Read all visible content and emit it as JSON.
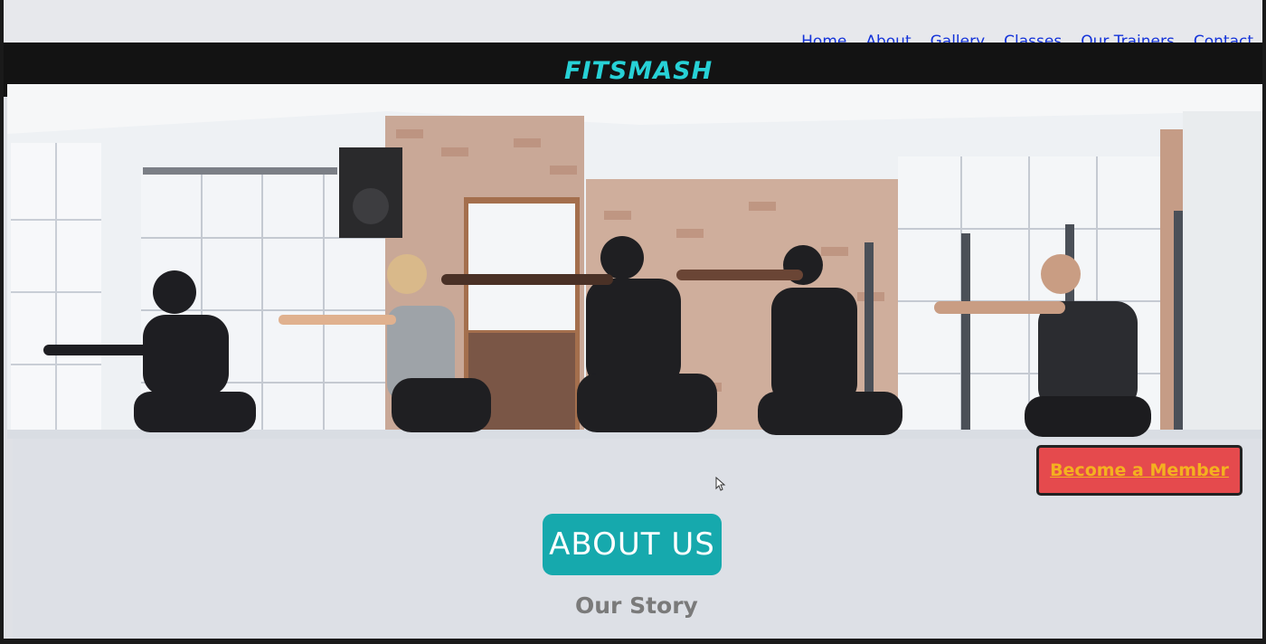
{
  "nav": {
    "items": [
      "Home",
      "About",
      "Gallery",
      "Classes",
      "Our Trainers",
      "Contact"
    ]
  },
  "brand": {
    "logo_text": "FITSMASH"
  },
  "hero": {
    "image_alt": "five people doing squats in a studio",
    "cta_label": "Become a Member"
  },
  "section": {
    "heading": "ABOUT US",
    "subheading": "Our Story"
  },
  "colors": {
    "nav_link": "#1433d9",
    "logo": "#27d1d6",
    "brand_bar": "#131313",
    "cta_bg": "#e54a4d",
    "cta_text": "#f4b11f",
    "about_bg": "#16a9ad",
    "story_text": "#7a7a7a"
  }
}
